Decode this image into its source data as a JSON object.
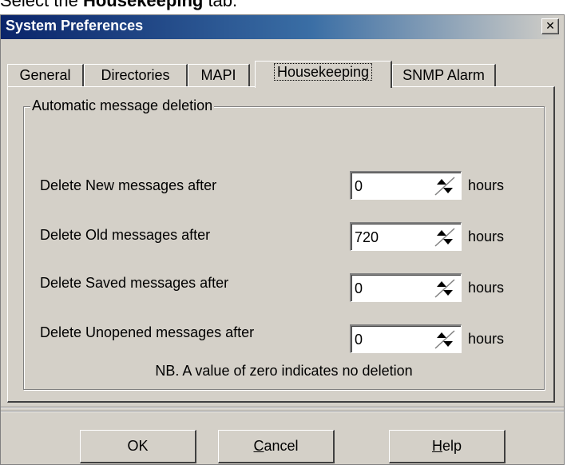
{
  "instruction": {
    "prefix": "Select the ",
    "bold": "Housekeeping",
    "suffix": " tab."
  },
  "window": {
    "title": "System Preferences",
    "close_symbol": "✕"
  },
  "tabs": [
    {
      "label": "General",
      "active": false
    },
    {
      "label": "Directories",
      "active": false
    },
    {
      "label": "MAPI",
      "active": false
    },
    {
      "label": "Housekeeping",
      "active": true
    },
    {
      "label": "SNMP Alarm",
      "active": false
    }
  ],
  "group": {
    "legend": "Automatic message deletion",
    "rows": [
      {
        "label": "Delete New messages after",
        "value": "0",
        "unit": "hours"
      },
      {
        "label": "Delete Old messages after",
        "value": "720",
        "unit": "hours"
      },
      {
        "label": "Delete Saved messages after",
        "value": "0",
        "unit": "hours"
      },
      {
        "label": "Delete Unopened messages after",
        "value": "0",
        "unit": "hours"
      }
    ],
    "note": "NB. A value of zero indicates no deletion"
  },
  "buttons": {
    "ok": "OK",
    "cancel": {
      "mnemonic": "C",
      "rest": "ancel"
    },
    "help": {
      "mnemonic": "H",
      "rest": "elp"
    }
  },
  "icons": {
    "close": "close-icon",
    "spinner": "spin-arrows-icon"
  },
  "colors": {
    "dialog_bg": "#d4d0c8",
    "title_start": "#0a246a",
    "title_end": "#d4d0c8"
  }
}
